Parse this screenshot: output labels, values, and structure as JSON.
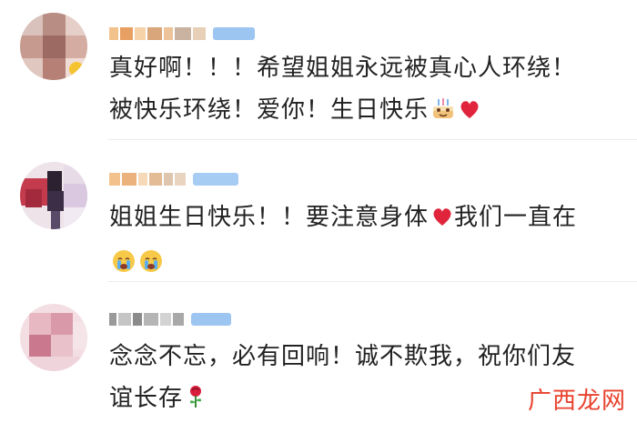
{
  "comments": [
    {
      "username_blurred": true,
      "line1": "真好啊！！！希望姐姐永远被真心人环绕！",
      "line2": "被快乐环绕！爱你！生日快乐",
      "line2_emojis": [
        "birthday-cake-emoji",
        "red-heart-emoji"
      ]
    },
    {
      "username_blurred": true,
      "line1_before_heart": "姐姐生日快乐！！要注意身体",
      "line1_after_heart": "我们一直在",
      "line1_emojis": [
        "red-heart-emoji"
      ],
      "line2_emojis": [
        "crying-face-emoji",
        "crying-face-emoji"
      ]
    },
    {
      "username_blurred": true,
      "line1": "念念不忘，必有回响！诚不欺我，祝你们友",
      "line2": "谊长存",
      "line2_emojis": [
        "rose-emoji"
      ]
    }
  ],
  "watermark": "广西龙网",
  "colors": {
    "text": "#222222",
    "heart": "#e0243c",
    "watermark": "#e8412c",
    "badge_blue": "#7fb4f0",
    "username_orange": "#f0a860"
  }
}
